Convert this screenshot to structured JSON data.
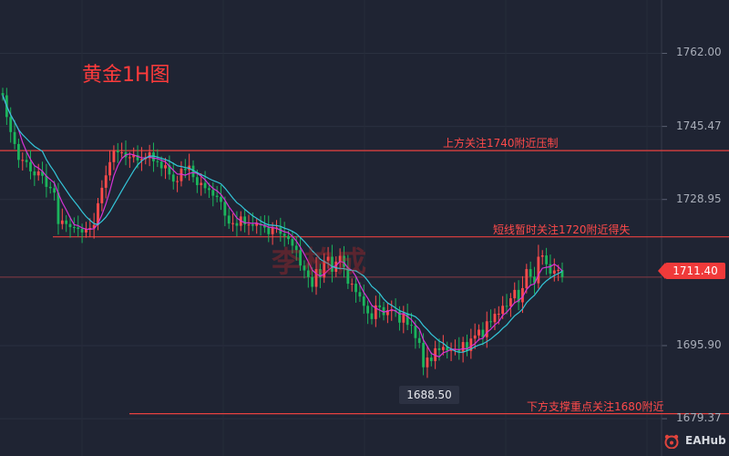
{
  "chart_data": {
    "type": "candlestick",
    "title": "黄金1H图",
    "ylim": [
      1673,
      1772
    ],
    "y_ticks": [
      {
        "value": 1762.0,
        "label": "1762.00"
      },
      {
        "value": 1745.47,
        "label": "1745.47"
      },
      {
        "value": 1728.95,
        "label": "1728.95"
      },
      {
        "value": 1695.9,
        "label": "1695.90"
      },
      {
        "value": 1679.37,
        "label": "1679.37"
      }
    ],
    "current_price": {
      "value": 1711.4,
      "label": "1711.40"
    },
    "low_marker": {
      "value": 1688.5,
      "label": "1688.50"
    },
    "levels": [
      {
        "value": 1740,
        "label": "上方关注1740附近压制"
      },
      {
        "value": 1720.5,
        "label": "短线暂时关注1720附近得失"
      },
      {
        "value": 1680.5,
        "label": "下方支撑重点关注1680附近"
      }
    ],
    "ma_series": [
      {
        "color": "#d633d6"
      },
      {
        "color": "#34c6d9"
      }
    ],
    "candles_closes": [
      1752.5,
      1747.6,
      1744.2,
      1741.5,
      1737.9,
      1737.9,
      1737.4,
      1735.3,
      1734.4,
      1735.3,
      1734.3,
      1731.8,
      1731.5,
      1730.5,
      1723.4,
      1724.2,
      1723.4,
      1722.7,
      1722.6,
      1722.3,
      1721.5,
      1722.2,
      1722.5,
      1723.2,
      1728.1,
      1731.6,
      1734.4,
      1737.4,
      1740.0,
      1739.6,
      1739.6,
      1738.5,
      1738.5,
      1739.0,
      1737.8,
      1738.1,
      1738.3,
      1739.6,
      1737.6,
      1737.5,
      1736.0,
      1736.7,
      1734.6,
      1733.0,
      1733.1,
      1735.9,
      1735.6,
      1736.6,
      1734.0,
      1732.2,
      1732.7,
      1731.5,
      1731.1,
      1729.8,
      1729.5,
      1728.4,
      1725.3,
      1723.5,
      1723.6,
      1723.0,
      1725.1,
      1723.3,
      1723.3,
      1723.0,
      1723.5,
      1723.2,
      1722.6,
      1721.1,
      1722.6,
      1722.6,
      1721.2,
      1720.7,
      1720.0,
      1718.5,
      1717.5,
      1714.0,
      1712.9,
      1711.4,
      1709.2,
      1713.2,
      1711.3,
      1715.1,
      1716.0,
      1712.6,
      1714.9,
      1716.2,
      1713.7,
      1709.9,
      1709.9,
      1708.0,
      1707.0,
      1704.9,
      1703.2,
      1701.9,
      1705.0,
      1704.6,
      1702.8,
      1703.9,
      1703.9,
      1703.6,
      1701.1,
      1703.2,
      1700.6,
      1700.4,
      1697.6,
      1696.5,
      1691.0,
      1693.2,
      1692.4,
      1695.3,
      1694.9,
      1695.6,
      1694.8,
      1694.9,
      1695.1,
      1694.5,
      1696.7,
      1694.7,
      1697.5,
      1698.2,
      1699.5,
      1697.8,
      1701.4,
      1701.2,
      1703.1,
      1703.1,
      1704.9,
      1704.8,
      1706.6,
      1708.5,
      1705.7,
      1708.9,
      1713.2,
      1711.5,
      1710.0,
      1716.0,
      1716.3,
      1714.3,
      1712.2,
      1712.9,
      1713.0,
      1711.4
    ]
  },
  "watermark": "李柏成",
  "logo": {
    "name": "EAHub"
  }
}
